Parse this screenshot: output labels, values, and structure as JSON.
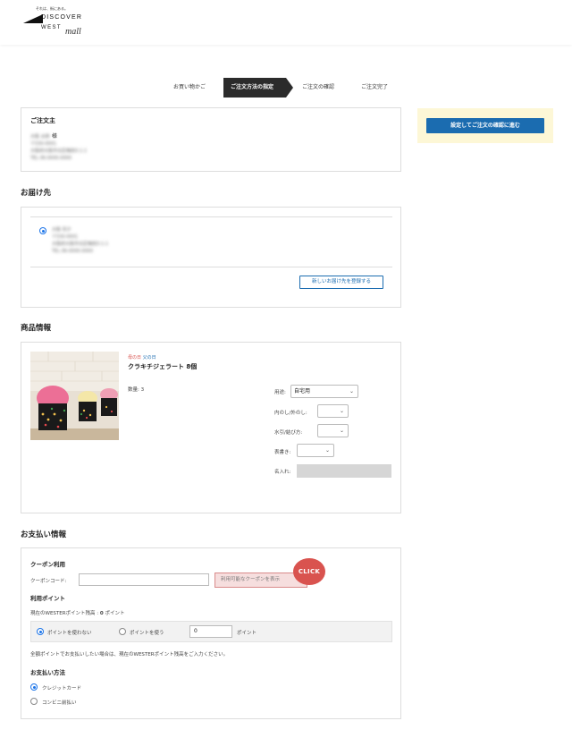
{
  "header": {
    "tagline": "それは、街にある。",
    "logo_line1": "DISCOVER",
    "logo_line2": "WEST",
    "logo_script": "mall"
  },
  "steps": [
    {
      "label": "お買い物かご",
      "active": false
    },
    {
      "label": "ご注文方法の指定",
      "active": true
    },
    {
      "label": "ご注文の確認",
      "active": false
    },
    {
      "label": "ご注文完了",
      "active": false
    }
  ],
  "orderer": {
    "title": "ご注文主",
    "name": "大阪 太郎",
    "suffix": "様",
    "lines": [
      "〒530-0001",
      "大阪府大阪市北区梅田3-1-1",
      "TEL 06-0000-0000"
    ]
  },
  "cta": {
    "label": "設定してご注文の確認に進む"
  },
  "delivery": {
    "title": "お届け先",
    "name": "大阪 花子",
    "lines": [
      "〒530-0001",
      "大阪府大阪市北区梅田3-1-1",
      "TEL 06-0000-0000"
    ],
    "register_button": "新しいお届け先を登録する"
  },
  "product": {
    "title": "商品情報",
    "tag_red": "母の日",
    "tag_blue": "父の日",
    "name": "クラキチジェラート 8個",
    "qty": "数量: 3",
    "usage_label": "用途:",
    "usage_value": "自宅用",
    "noshi_label": "内のし/外のし:",
    "mizuhiki_label": "水引/結び方:",
    "omotegaki_label": "表書き:",
    "naire_label": "名入れ:"
  },
  "payment": {
    "title": "お支払い情報",
    "coupon_title": "クーポン利用",
    "coupon_label": "クーポンコード:",
    "coupon_button": "利用可能なクーポンを表示",
    "click_badge": "CLICK",
    "points_title": "利用ポイント",
    "points_balance_prefix": "現在のWESTERポイント残高 : ",
    "points_balance_value": "0",
    "points_balance_suffix": " ポイント",
    "points_opt_none": "ポイントを使わない",
    "points_opt_use": "ポイントを使う",
    "points_input": "0",
    "points_unit": "ポイント",
    "points_note": "全額ポイントでお支払いしたい場合は、現在のWESTERポイント残高をご入力ください。",
    "method_title": "お支払い方法",
    "method_credit": "クレジットカード",
    "method_cvs": "コンビニ前払い"
  },
  "colors": {
    "accent": "#1b6cb0",
    "cta_panel": "#fdf7d6",
    "click_badge": "#d9534f",
    "step_active": "#2b2b2b"
  }
}
